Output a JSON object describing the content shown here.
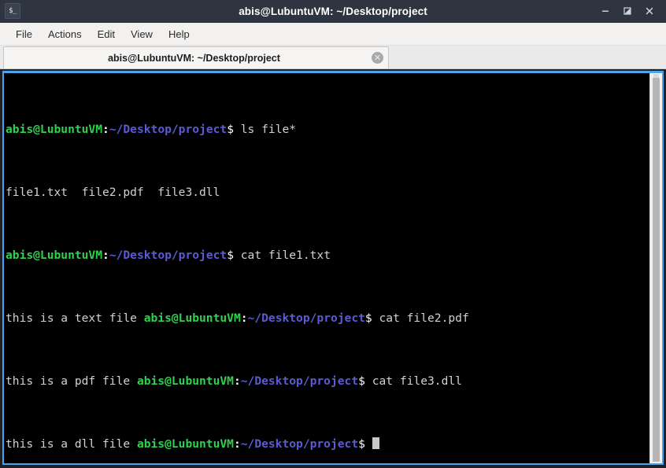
{
  "window": {
    "title": "abis@LubuntuVM: ~/Desktop/project",
    "icon": "terminal-icon",
    "icon_glyph": "$_",
    "controls": {
      "minimize": "minimize-icon",
      "maximize": "maximize-icon",
      "close": "close-icon",
      "close_glyph": "✕",
      "minimize_glyph": "–"
    },
    "colors": {
      "titlebar_bg": "#2e3440",
      "frame_border": "#4da3e8",
      "terminal_bg": "#000000",
      "prompt_user": "#2fd14f",
      "prompt_path": "#5b5bd6",
      "text": "#d2d2d2"
    }
  },
  "menubar": {
    "items": [
      {
        "label": "File"
      },
      {
        "label": "Actions"
      },
      {
        "label": "Edit"
      },
      {
        "label": "View"
      },
      {
        "label": "Help"
      }
    ]
  },
  "tabs": [
    {
      "label": "abis@LubuntuVM: ~/Desktop/project",
      "close_glyph": "✕",
      "active": true
    }
  ],
  "terminal": {
    "prompt": {
      "user_host": "abis@LubuntuVM",
      "colon": ":",
      "path": "~/Desktop/project",
      "dollar": "$"
    },
    "lines": [
      {
        "type": "prompt_command",
        "command": " ls file*"
      },
      {
        "type": "output",
        "text": "file1.txt  file2.pdf  file3.dll"
      },
      {
        "type": "prompt_command",
        "command": " cat file1.txt"
      },
      {
        "type": "output_then_prompt",
        "output": "this is a text file ",
        "command": " cat file2.pdf"
      },
      {
        "type": "output_then_prompt",
        "output": "this is a pdf file ",
        "command": " cat file3.dll"
      },
      {
        "type": "output_then_prompt_cursor",
        "output": "this is a dll file ",
        "command": " "
      }
    ],
    "line_texts": {
      "l1_cmd": " ls file*",
      "l2_out": "file1.txt  file2.pdf  file3.dll",
      "l3_cmd": " cat file1.txt",
      "l4_out": "this is a text file ",
      "l4_cmd": " cat file2.pdf",
      "l5_out": "this is a pdf file ",
      "l5_cmd": " cat file3.dll",
      "l6_out": "this is a dll file ",
      "l6_cmd": " "
    }
  },
  "scrollbar": {
    "orientation": "vertical",
    "thumb_position": "full"
  }
}
